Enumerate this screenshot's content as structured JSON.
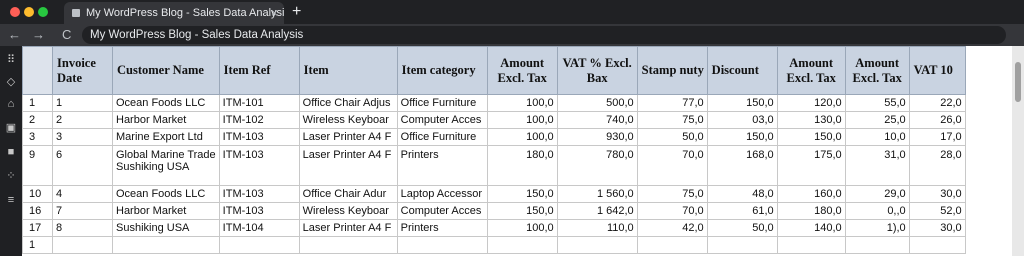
{
  "browser": {
    "tab_title": "My WordPress Blog - Sales Data Analysis",
    "tab_close": "×",
    "new_tab": "+",
    "address": "My WordPress Blog - Sales Data Analysis",
    "back": "←",
    "forward": "→",
    "reload": "C"
  },
  "sidebar": {
    "icons": [
      "grid-icon",
      "shield-icon",
      "home-icon",
      "chart-icon",
      "lock-icon",
      "apps-icon",
      "menu-icon"
    ]
  },
  "table": {
    "headers": [
      "Invoice Date",
      "Customer Name",
      "Item Ref",
      "Item",
      "Item category",
      "Amount Excl. Tax",
      "VAT % Excl. Bax",
      "Stamp nuty",
      "Discount",
      "Amount Excl. Tax",
      "Amount Excl. Tax",
      "VAT 10"
    ],
    "rows": [
      {
        "rh": "1",
        "cells": [
          "1",
          "Ocean Foods LLC",
          "ITM-101",
          "Office Chair Adjus",
          "Office Furniture",
          "100,0",
          "500,0",
          "77,0",
          "150,0",
          "120,0",
          "55,0",
          "22,0"
        ]
      },
      {
        "rh": "2",
        "cells": [
          "2",
          "Harbor Market",
          "ITM-102",
          "Wireless Keyboar",
          "Computer Acces",
          "100,0",
          "740,0",
          "75,0",
          "03,0",
          "130,0",
          "25,0",
          "26,0"
        ]
      },
      {
        "rh": "3",
        "cells": [
          "3",
          "Marine Export Ltd",
          "ITM-103",
          "Laser Printer A4 F",
          "Office Furniture",
          "100,0",
          "930,0",
          "50,0",
          "150,0",
          "150,0",
          "10,0",
          "17,0"
        ]
      },
      {
        "rh": "9",
        "cells": [
          "6",
          "Global Marine Trade\nSushiking USA",
          "ITM-103",
          "Laser Printer A4 F",
          "Printers",
          "180,0",
          "780,0",
          "70,0",
          "168,0",
          "175,0",
          "31,0",
          "28,0"
        ]
      },
      {
        "rh": "10",
        "cells": [
          "4",
          "Ocean Foods LLC",
          "ITM-103",
          "Office Chair Adur",
          "Laptop Accessor",
          "150,0",
          "1 560,0",
          "75,0",
          "48,0",
          "160,0",
          "29,0",
          "30,0"
        ]
      },
      {
        "rh": "16",
        "cells": [
          "7",
          "Harbor Market",
          "ITM-103",
          "Wireless Keyboar",
          "Computer Acces",
          "150,0",
          "1 642,0",
          "70,0",
          "61,0",
          "180,0",
          "0,,0",
          "52,0"
        ]
      },
      {
        "rh": "17",
        "cells": [
          "8",
          "Sushiking USA",
          "ITM-104",
          "Laser Printer A4 F",
          "Printers",
          "100,0",
          "110,0",
          "42,0",
          "50,0",
          "140,0",
          "1),0",
          "30,0"
        ]
      },
      {
        "rh": "1",
        "cells": [
          "",
          "",
          "",
          "",
          "",
          "",
          "",
          "",
          "",
          "",
          "",
          ""
        ]
      }
    ]
  }
}
